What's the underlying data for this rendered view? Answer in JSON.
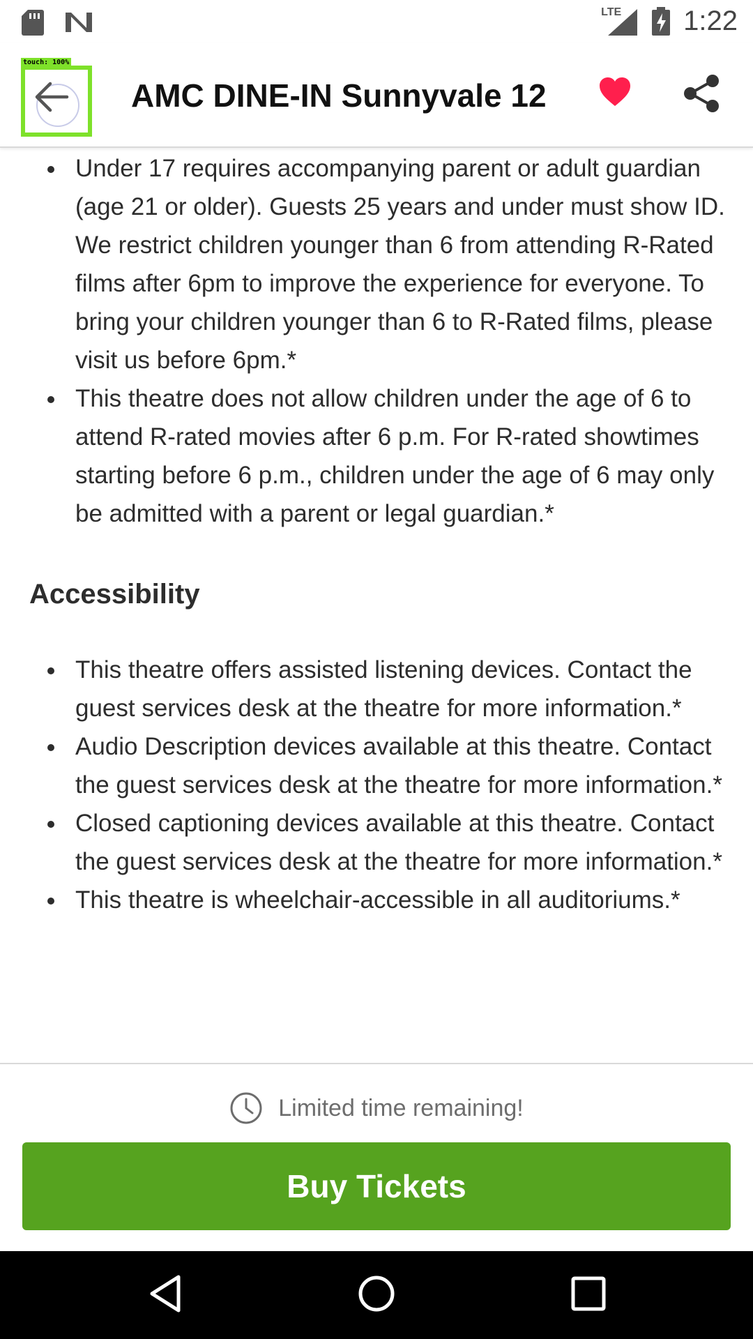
{
  "status_bar": {
    "time": "1:22",
    "network_label": "LTE",
    "icons": [
      "sd-card-icon",
      "n-logo-icon",
      "signal-icon",
      "battery-charging-icon"
    ]
  },
  "app_bar": {
    "title": "AMC DINE-IN Sunnyvale 12",
    "touch_label": "touch: 100%",
    "icons": [
      "back-arrow-icon",
      "heart-icon",
      "share-icon"
    ],
    "heart_color": "#ff1f4d"
  },
  "policy_items": [
    "Under 17 requires accompanying parent or adult guardian (age 21 or older). Guests 25 years and under must show ID. We restrict children younger than 6 from attending R-Rated films after 6pm to improve the experience for everyone. To bring your children younger than 6 to R-Rated films, please visit us before 6pm.*",
    "This theatre does not allow children under the age of 6 to attend R-rated movies after 6 p.m. For R-rated showtimes starting before 6 p.m., children under the age of 6 may only be admitted with a parent or legal guardian.*"
  ],
  "accessibility": {
    "heading": "Accessibility",
    "items": [
      "This theatre offers assisted listening devices. Contact the guest services desk at the theatre for more information.*",
      "Audio Description devices available at this theatre. Contact the guest services desk at the theatre for more information.*",
      "Closed captioning devices available at this theatre. Contact the guest services desk at the theatre for more information.*",
      "This theatre is wheelchair-accessible in all auditoriums.*"
    ]
  },
  "bottom": {
    "limited_text": "Limited time remaining!",
    "buy_label": "Buy Tickets",
    "buy_color": "#56a31f"
  },
  "nav_bar": {
    "icons": [
      "nav-back-icon",
      "nav-home-icon",
      "nav-recents-icon"
    ]
  }
}
